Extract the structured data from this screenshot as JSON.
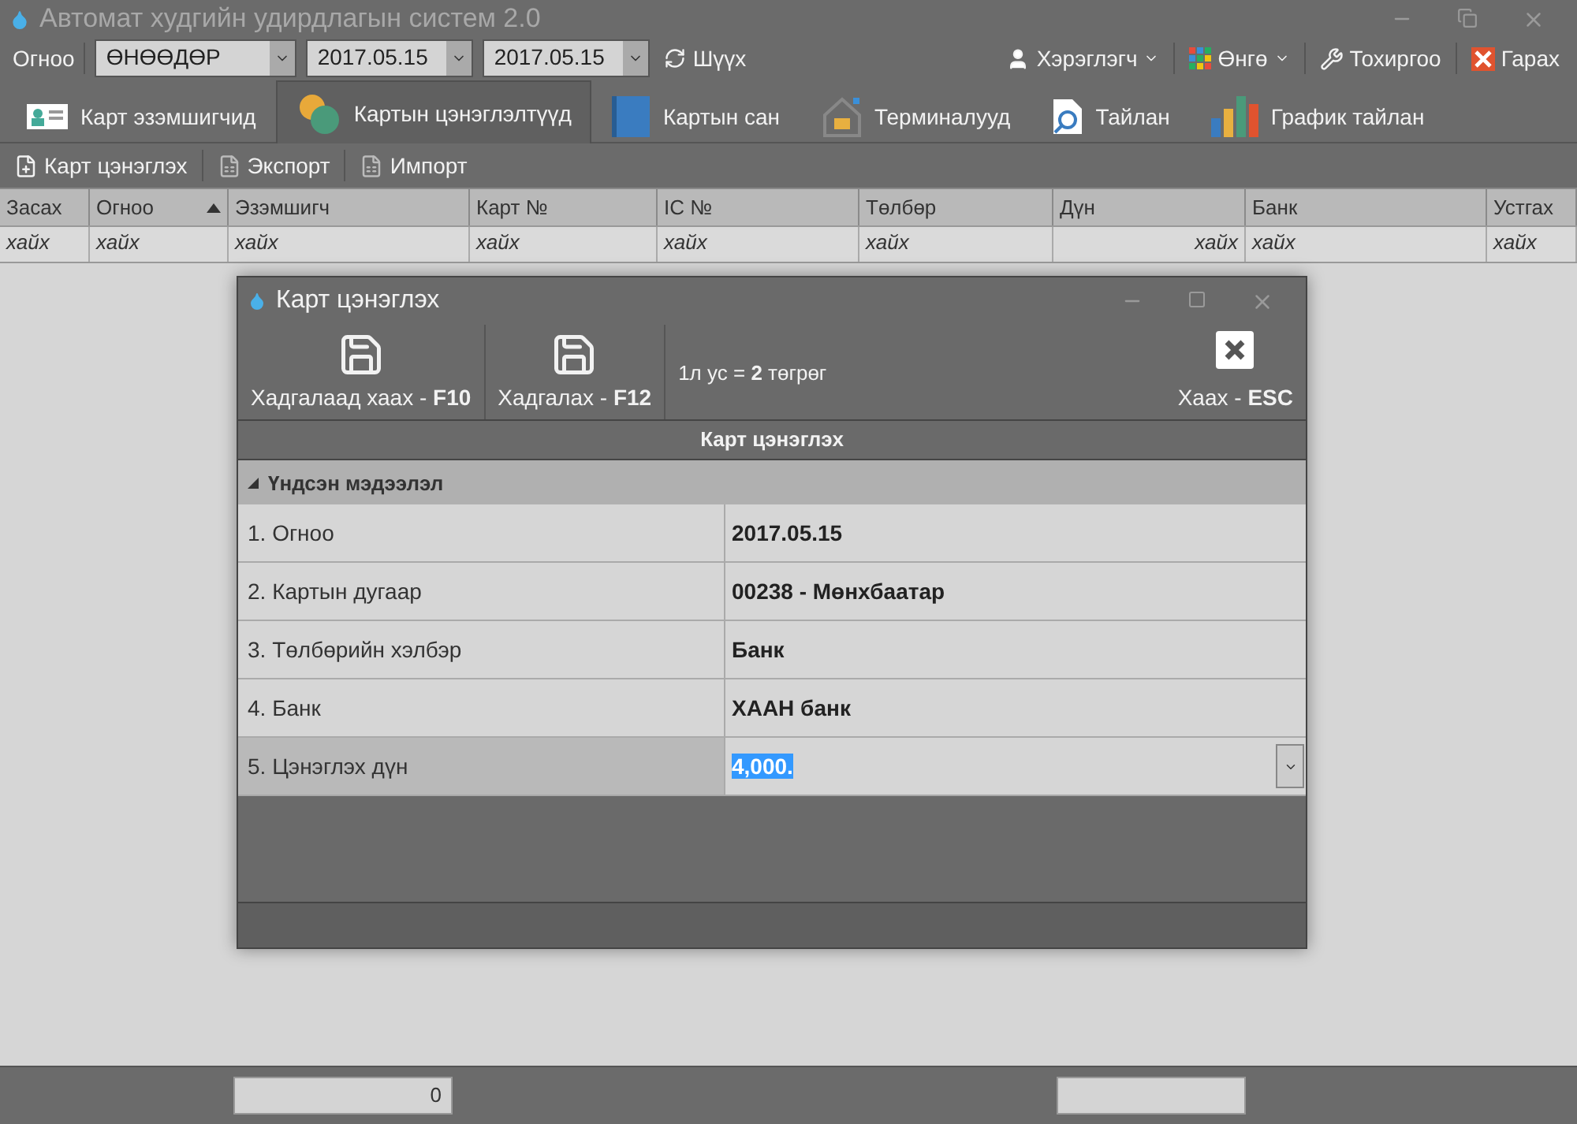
{
  "window": {
    "title": "Автомат худгийн удирдлагын систем 2.0"
  },
  "filter_bar": {
    "label": "Огноо",
    "period": "ӨНӨӨДӨР",
    "date_from": "2017.05.15",
    "date_to": "2017.05.15",
    "filter_button": "Шүүх"
  },
  "top_menu": [
    {
      "label": "Хэрэглэгч",
      "kind": "user",
      "dropdown": true
    },
    {
      "label": "Өнгө",
      "kind": "color",
      "dropdown": true
    },
    {
      "label": "Тохиргоо",
      "kind": "settings",
      "dropdown": false
    },
    {
      "label": "Гарах",
      "kind": "exit",
      "dropdown": false
    }
  ],
  "tabs": [
    {
      "label": "Карт эзэмшигчид",
      "kind": "card",
      "selected": false
    },
    {
      "label": "Картын цэнэглэлтүүд",
      "kind": "coins",
      "selected": true
    },
    {
      "label": "Картын сан",
      "kind": "book",
      "selected": false
    },
    {
      "label": "Терминалууд",
      "kind": "home",
      "selected": false
    },
    {
      "label": "Тайлан",
      "kind": "report",
      "selected": false
    },
    {
      "label": "График тайлан",
      "kind": "chart",
      "selected": false
    }
  ],
  "actions": [
    {
      "label": "Карт цэнэглэх",
      "kind": "new"
    },
    {
      "label": "Экспорт",
      "kind": "excel"
    },
    {
      "label": "Импорт",
      "kind": "excel"
    }
  ],
  "table": {
    "columns": [
      {
        "label": "Засах",
        "kind": "text",
        "sorted": false
      },
      {
        "label": "Огноо",
        "kind": "text",
        "sorted": true
      },
      {
        "label": "Эзэмшигч",
        "kind": "text",
        "sorted": false
      },
      {
        "label": "Карт №",
        "kind": "text",
        "sorted": false
      },
      {
        "label": "IC №",
        "kind": "text",
        "sorted": false
      },
      {
        "label": "Төлбөр",
        "kind": "text",
        "sorted": false
      },
      {
        "label": "Дүн",
        "kind": "number",
        "sorted": false
      },
      {
        "label": "Банк",
        "kind": "text",
        "sorted": false
      },
      {
        "label": "Устгах",
        "kind": "text",
        "sorted": false
      }
    ],
    "filter_row": [
      "хайх",
      "хайх",
      "хайх",
      "хайх",
      "хайх",
      "хайх",
      "хайх",
      "хайх",
      "хайх"
    ]
  },
  "footer": {
    "total": "0"
  },
  "dialog": {
    "title": "Карт цэнэглэх",
    "buttons": [
      {
        "label": "Хадгалаад хаах - **F10**",
        "kind": "save"
      },
      {
        "label": "Хадгалах - **F12**",
        "kind": "save"
      }
    ],
    "rate": "1л ус = **2** төгрөг",
    "close": "Хаах - **ESC**",
    "caption": "Карт цэнэглэх",
    "group": {
      "title": "Үндсэн мэдээлэл",
      "expanded": true
    },
    "rows": [
      {
        "label": "1. Огноо",
        "value": "2017.05.15",
        "selected": false
      },
      {
        "label": "2. Картын дугаар",
        "value": "00238 - Мөнхбаатар",
        "selected": false
      },
      {
        "label": "3. Төлбөрийн хэлбэр",
        "value": "Банк",
        "selected": false
      },
      {
        "label": "4. Банк",
        "value": "ХААН банк",
        "selected": false
      },
      {
        "label": "5. Цэнэглэх дүн",
        "value": "4,000.",
        "selected": true
      }
    ]
  }
}
